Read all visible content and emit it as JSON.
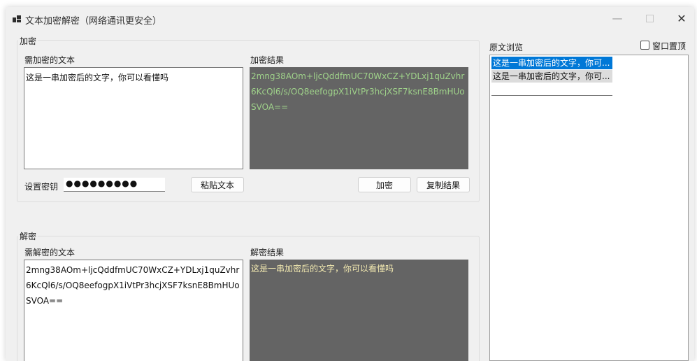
{
  "window": {
    "title": "文本加密解密（网络通讯更安全）",
    "min_glyph": "—",
    "close_glyph": "✕"
  },
  "encrypt": {
    "group_label": "加密",
    "input_label": "需加密的文本",
    "input_value": "这是一串加密后的文字，你可以看懂吗",
    "result_label": "加密结果",
    "result_value": "2mng38AOm+ljcQddfmUC70WxCZ+YDLxj1quZvhr6KcQl6/s/OQ8eefogpX1iVtPr3hcjXSF7ksnE8BmHUoSVOA==",
    "key_label": "设置密钥",
    "key_value": "●●●●●●●●●",
    "paste_button": "粘贴文本",
    "encrypt_button": "加密",
    "copy_button": "复制结果"
  },
  "decrypt": {
    "group_label": "解密",
    "input_label": "需解密的文本",
    "input_value": "2mng38AOm+ljcQddfmUC70WxCZ+YDLxj1quZvhr6KcQl6/s/OQ8eefogpX1iVtPr3hcjXSF7ksnE8BmHUoSVOA==",
    "result_label": "解密结果",
    "result_value": "这是一串加密后的文字，你可以看懂吗"
  },
  "preview": {
    "label": "原文浏览",
    "topmost_label": "窗口置顶",
    "topmost_checked": false,
    "items": [
      "这是一串加密后的文字，你可...",
      "这是一串加密后的文字，你可..."
    ]
  },
  "colors": {
    "window_bg": "#f0f0f0",
    "result_bg": "#646464",
    "encrypt_result_text": "#9fd28a",
    "decrypt_result_text": "#f2e9b0",
    "selection": "#0078d7"
  }
}
